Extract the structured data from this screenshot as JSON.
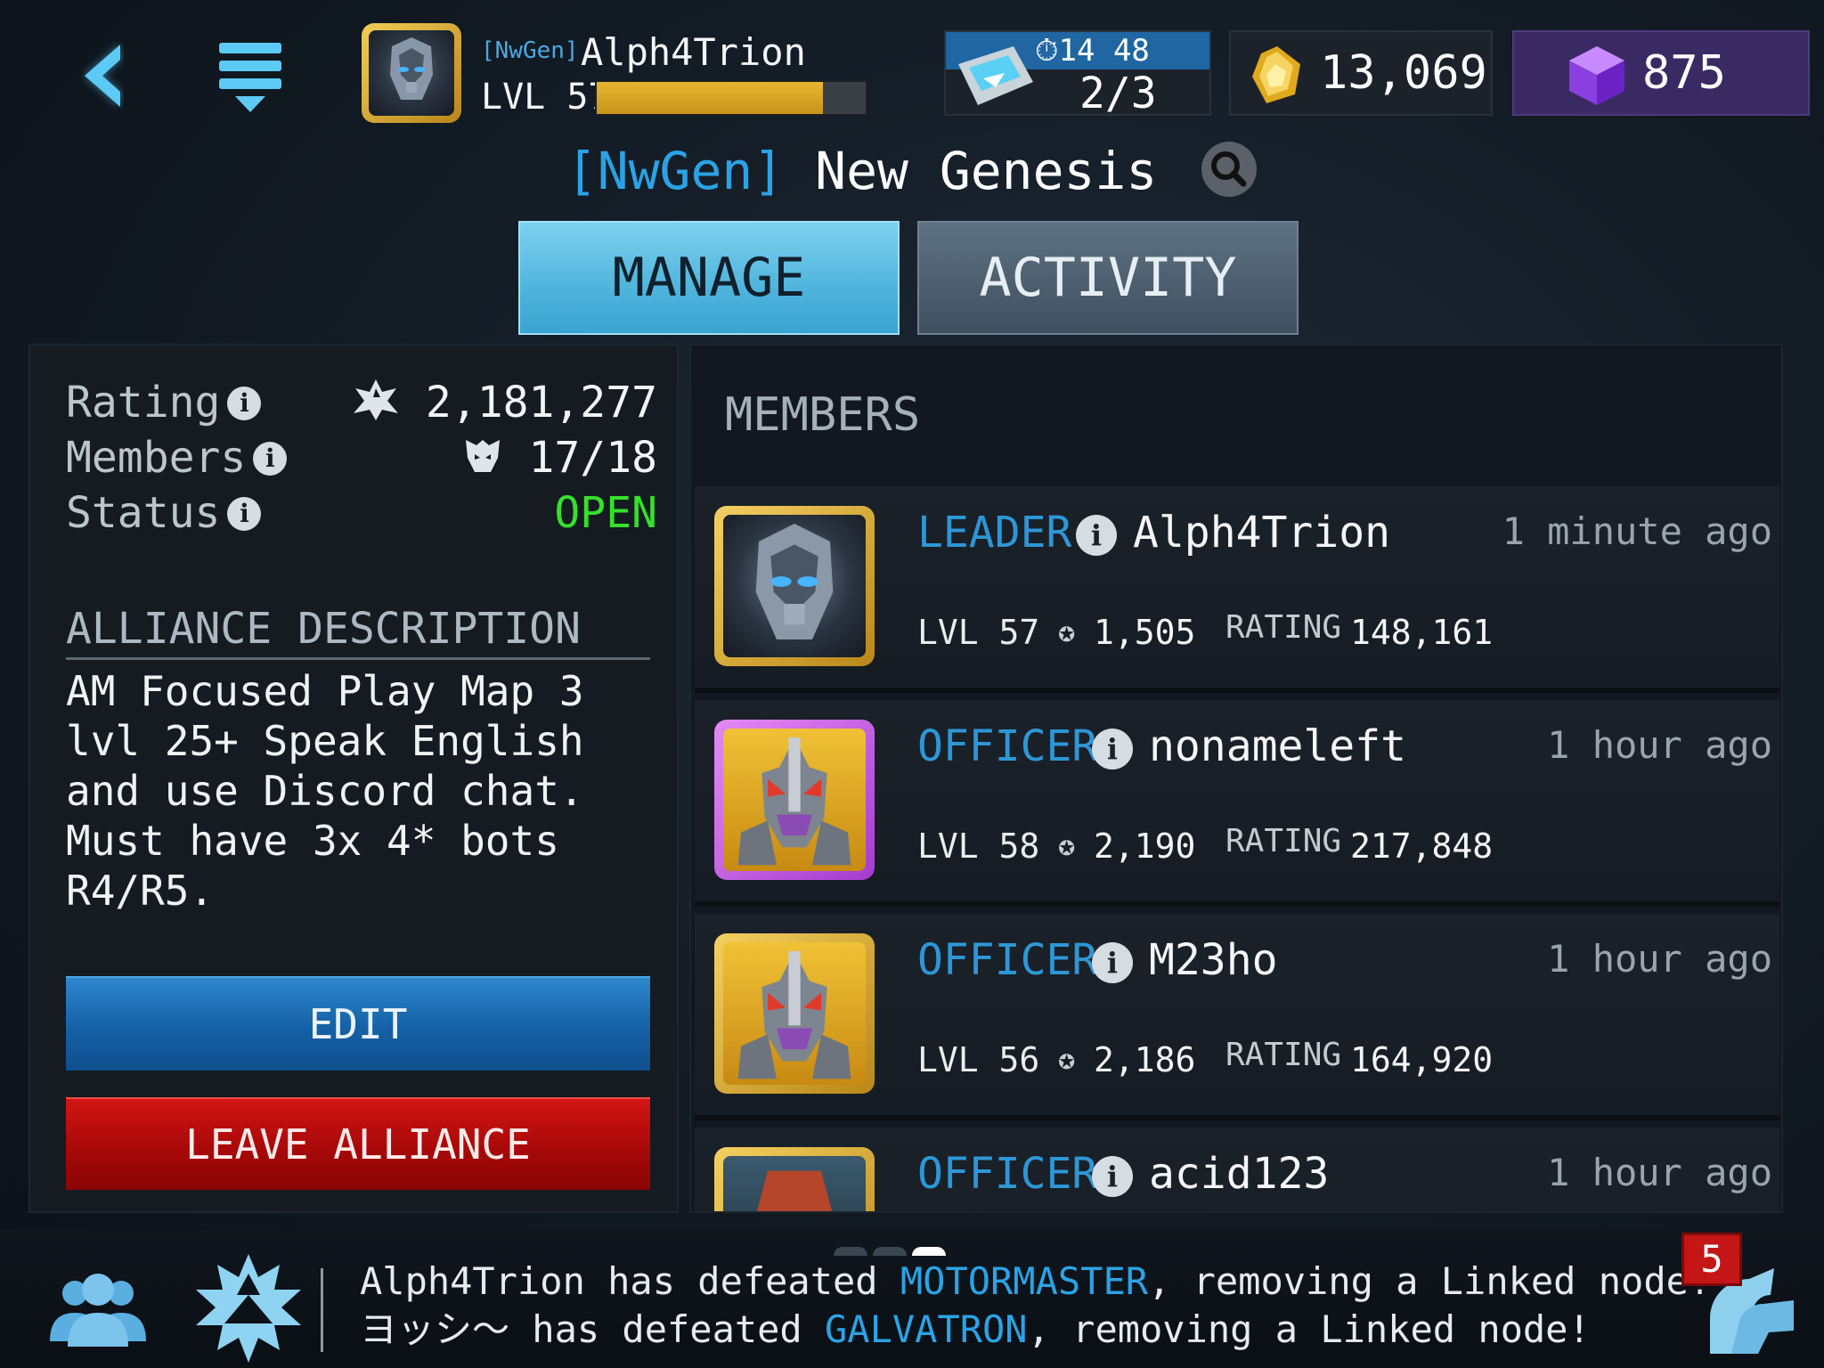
{
  "player": {
    "tag": "[NwGen]",
    "name": "Alph4Trion",
    "level_label": "LVL 57",
    "xp_progress": 0.84
  },
  "energy": {
    "timer": "14 48",
    "count": "2/3"
  },
  "currency": {
    "gold": "13,069",
    "gems": "875"
  },
  "alliance": {
    "tag": "[NwGen]",
    "name": "New Genesis"
  },
  "tabs": {
    "manage": "MANAGE",
    "activity": "ACTIVITY"
  },
  "stats": {
    "rating_label": "Rating",
    "rating_value": "2,181,277",
    "members_label": "Members",
    "members_value": "17/18",
    "status_label": "Status",
    "status_value": "OPEN"
  },
  "description": {
    "heading": "ALLIANCE DESCRIPTION",
    "text": "AM Focused Play Map 3 lvl 25+ Speak English and use Discord chat. Must have 3x 4* bots R4/R5."
  },
  "buttons": {
    "edit": "EDIT",
    "leave": "LEAVE ALLIANCE"
  },
  "members": {
    "heading": "MEMBERS",
    "rating_label": "RATING",
    "list": [
      {
        "role": "LEADER",
        "name": "Alph4Trion",
        "time": "1 minute ago",
        "level": "LVL 57",
        "score": "1,505",
        "rating": "148,161",
        "frame": "gold",
        "portrait": "optimus"
      },
      {
        "role": "OFFICER",
        "name": "nonameleft",
        "time": "1 hour ago",
        "level": "LVL 58",
        "score": "2,190",
        "rating": "217,848",
        "frame": "purple",
        "portrait": "starscream"
      },
      {
        "role": "OFFICER",
        "name": "M23ho",
        "time": "1 hour ago",
        "level": "LVL 56",
        "score": "2,186",
        "rating": "164,920",
        "frame": "gold",
        "portrait": "starscream"
      },
      {
        "role": "OFFICER",
        "name": "acid123",
        "time": "1 hour ago",
        "level": "",
        "score": "",
        "rating": "",
        "frame": "gold",
        "portrait": "other"
      }
    ]
  },
  "feed": {
    "line1_pre": "Alph4Trion has defeated ",
    "line1_hl": "MOTORMASTER",
    "line1_post": ", removing a Linked node!",
    "line2_pre": "ヨッシ〜 has defeated ",
    "line2_hl": "GALVATRON",
    "line2_post": ", removing a Linked node!"
  },
  "chat_badge": "5",
  "colors": {
    "accent_blue": "#2aa3e6",
    "open_green": "#35e02c",
    "leave_red": "#a50808",
    "gold_frame": "#d9a92c",
    "purple_frame": "#b84ee0"
  }
}
